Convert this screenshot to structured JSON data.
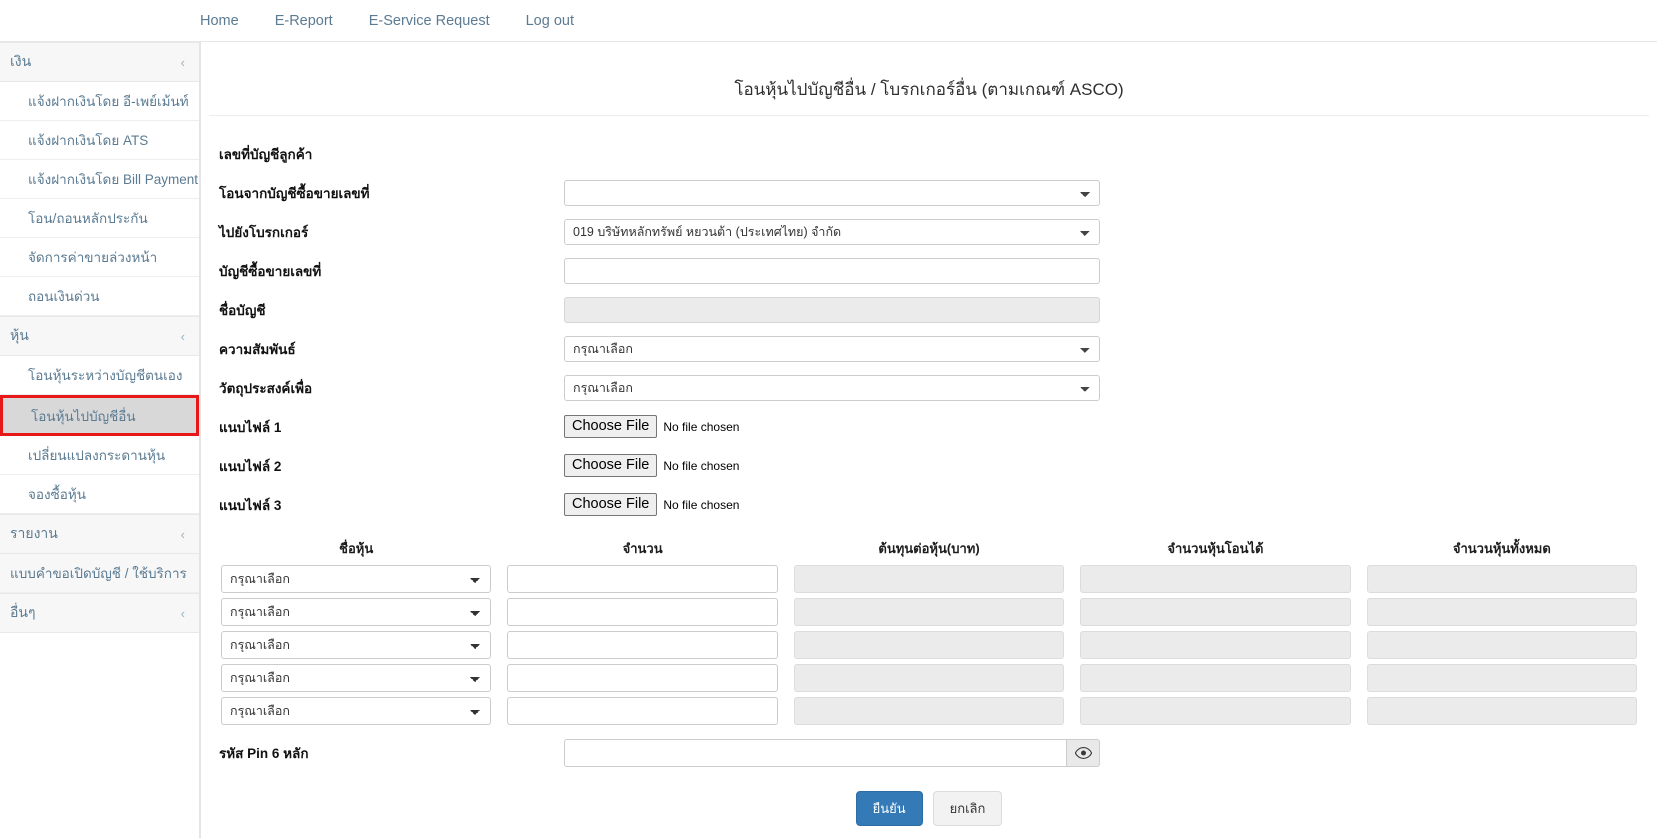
{
  "topnav": {
    "items": [
      {
        "label": "Home",
        "name": "home"
      },
      {
        "label": "E-Report",
        "name": "e-report"
      },
      {
        "label": "E-Service Request",
        "name": "e-service-request"
      },
      {
        "label": "Log out",
        "name": "log-out"
      }
    ]
  },
  "sidebar": {
    "groups": [
      {
        "label": "เงิน",
        "items": [
          "แจ้งฝากเงินโดย อี-เพย์เม้นท์",
          "แจ้งฝากเงินโดย ATS",
          "แจ้งฝากเงินโดย Bill Payment",
          "โอน/ถอนหลักประกัน",
          "จัดการค่าขายล่วงหน้า",
          "ถอนเงินด่วน"
        ]
      },
      {
        "label": "หุ้น",
        "items": [
          "โอนหุ้นระหว่างบัญชีตนเอง",
          "โอนหุ้นไปบัญชีอื่น",
          "เปลี่ยนแปลงกระดานหุ้น",
          "จองซื้อหุ้น"
        ],
        "active_index": 1
      },
      {
        "label": "รายงาน",
        "items": []
      }
    ],
    "plain_item": "แบบคำขอเปิดบัญชี / ใช้บริการ",
    "last_group": "อื่นๆ",
    "chevron_glyph": "‹",
    "active_highlight_color": "#e81818"
  },
  "main": {
    "title": "โอนหุ้นไปบัญชีอื่น / โบรกเกอร์อื่น (ตามเกณฑ์ ASCO)",
    "fields": [
      {
        "label": "เลขที่บัญชีลูกค้า",
        "type": "none",
        "value": ""
      },
      {
        "label": "โอนจากบัญชีซื้อขายเลขที่",
        "type": "select",
        "value": ""
      },
      {
        "label": "ไปยังโบรกเกอร์",
        "type": "select",
        "value": "019 บริษัทหลักทรัพย์ หยวนต้า (ประเทศไทย) จำกัด"
      },
      {
        "label": "บัญชีซื้อขายเลขที่",
        "type": "text",
        "value": ""
      },
      {
        "label": "ชื่อบัญชี",
        "type": "readonly",
        "value": ""
      },
      {
        "label": "ความสัมพันธ์",
        "type": "select",
        "value": "กรุณาเลือก"
      },
      {
        "label": "วัตถุประสงค์เพื่อ",
        "type": "select",
        "value": "กรุณาเลือก"
      },
      {
        "label": "แนบไฟล์ 1",
        "type": "file",
        "value": ""
      },
      {
        "label": "แนบไฟล์ 2",
        "type": "file",
        "value": ""
      },
      {
        "label": "แนบไฟล์ 3",
        "type": "file",
        "value": ""
      }
    ],
    "file_button_label": "Choose File",
    "file_status_label": "No file chosen",
    "table": {
      "headers": [
        "ชื่อหุ้น",
        "จำนวน",
        "ต้นทุนต่อหุ้น(บาท)",
        "จำนวนหุ้นโอนได้",
        "จำนวนหุ้นทั้งหมด"
      ],
      "rows": [
        {
          "stock": "กรุณาเลือก",
          "amount": "",
          "cost": "",
          "transferable": "",
          "total": ""
        },
        {
          "stock": "กรุณาเลือก",
          "amount": "",
          "cost": "",
          "transferable": "",
          "total": ""
        },
        {
          "stock": "กรุณาเลือก",
          "amount": "",
          "cost": "",
          "transferable": "",
          "total": ""
        },
        {
          "stock": "กรุณาเลือก",
          "amount": "",
          "cost": "",
          "transferable": "",
          "total": ""
        },
        {
          "stock": "กรุณาเลือก",
          "amount": "",
          "cost": "",
          "transferable": "",
          "total": ""
        }
      ]
    },
    "pin": {
      "label": "รหัส Pin 6 หลัก",
      "value": "",
      "toggle_icon": "eye-icon"
    },
    "buttons": {
      "submit": "ยืนยัน",
      "cancel": "ยกเลิก",
      "submit_color": "#337ab7"
    }
  }
}
